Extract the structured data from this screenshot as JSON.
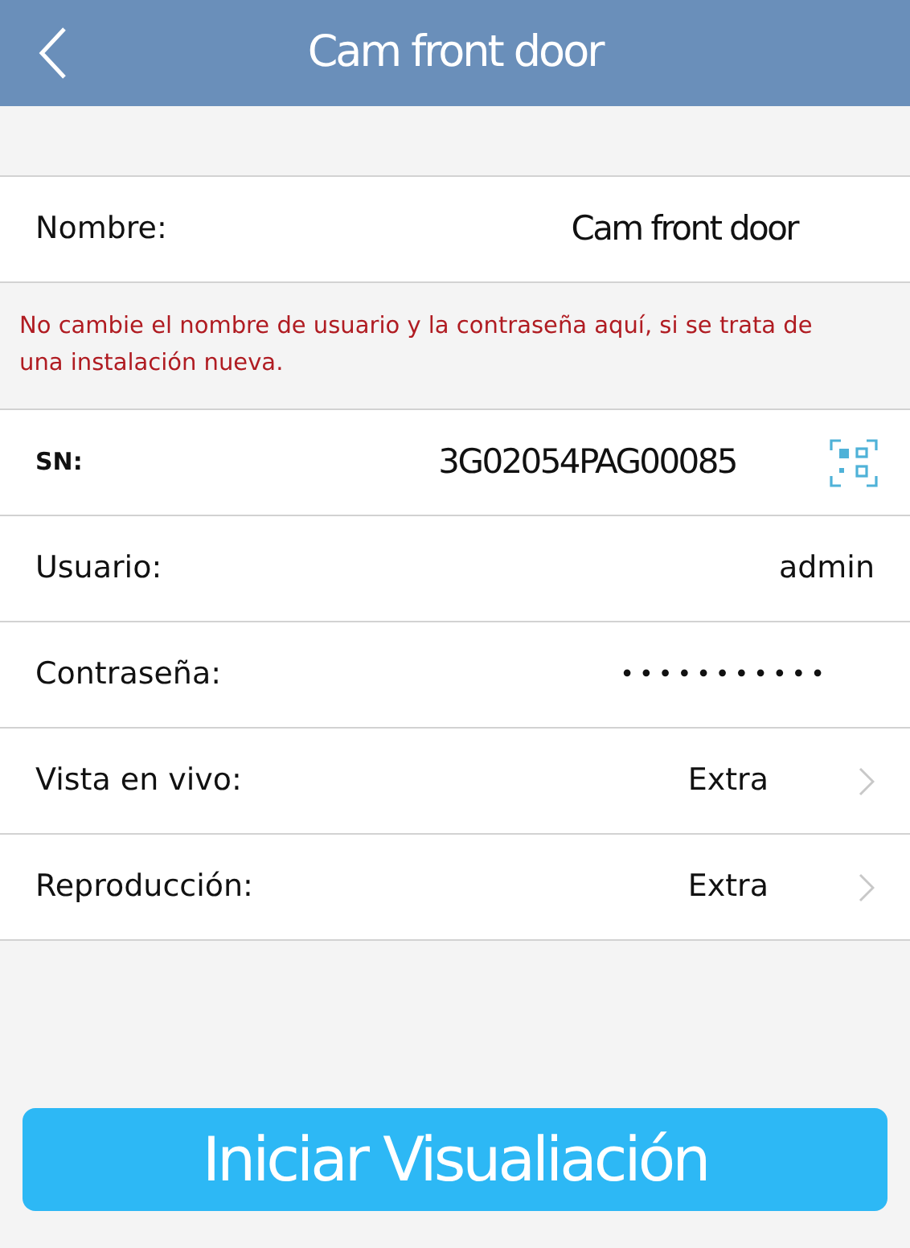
{
  "header": {
    "title": "Cam front door"
  },
  "name_row": {
    "label": "Nombre:",
    "value": "Cam front door"
  },
  "warning": "No cambie el nombre de usuario y la contraseña aquí, si se trata de una instalación nueva.",
  "rows": [
    {
      "kind": "qr",
      "label": "SN:",
      "value": "3G02054PAG00085"
    },
    {
      "kind": "text",
      "label": "Usuario:",
      "value": "admin"
    },
    {
      "kind": "password",
      "label": "Contraseña:",
      "value": "•••••••••••"
    },
    {
      "kind": "select",
      "label": "Vista en vivo:",
      "value": "Extra"
    },
    {
      "kind": "select",
      "label": "Reproducción:",
      "value": "Extra"
    }
  ],
  "button": "Iniciar Visualiación"
}
